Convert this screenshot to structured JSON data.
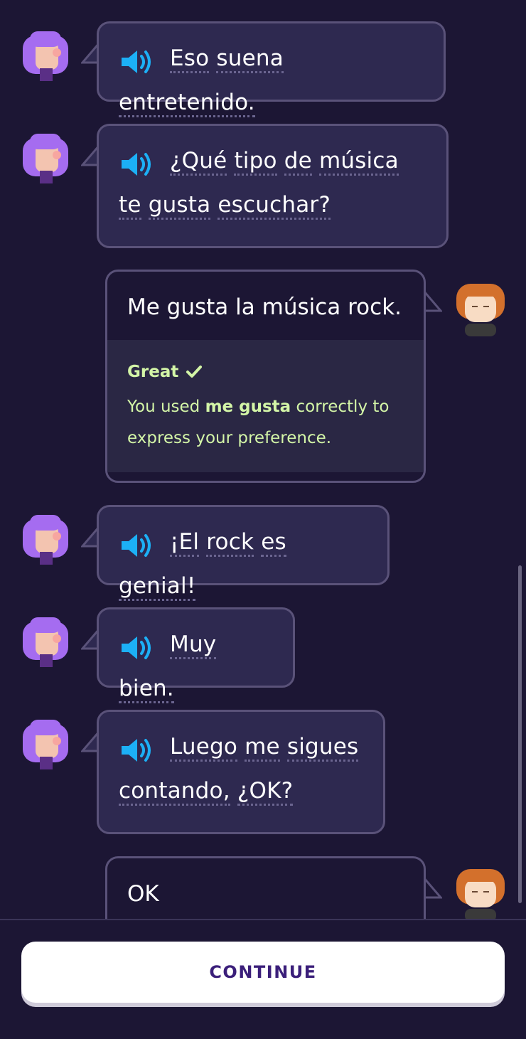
{
  "messages": [
    {
      "role": "bot",
      "words": [
        "Eso",
        "suena",
        "entretenido."
      ]
    },
    {
      "role": "bot",
      "words": [
        "¿Qué",
        "tipo",
        "de",
        "música",
        "te",
        "gusta",
        "escuchar?"
      ]
    },
    {
      "role": "user",
      "text": "Me gusta la música rock.",
      "feedback": {
        "title": "Great",
        "text_before": "You used ",
        "text_bold": "me gusta",
        "text_after": " correctly to express your preference."
      }
    },
    {
      "role": "bot",
      "words": [
        "¡El",
        "rock",
        "es",
        "genial!"
      ]
    },
    {
      "role": "bot",
      "words": [
        "Muy",
        "bien."
      ]
    },
    {
      "role": "bot",
      "words": [
        "Luego",
        "me",
        "sigues",
        "contando,",
        "¿OK?"
      ]
    },
    {
      "role": "user",
      "text": "OK"
    }
  ],
  "continue_label": "CONTINUE",
  "colors": {
    "background": "#1c1634",
    "bubble": "#2e2950",
    "feedback_text": "#d3f5a7",
    "speaker": "#1cb0f6",
    "button_text": "#3b1f7a"
  },
  "icons": {
    "speaker": "speaker-icon",
    "check": "check-icon"
  }
}
